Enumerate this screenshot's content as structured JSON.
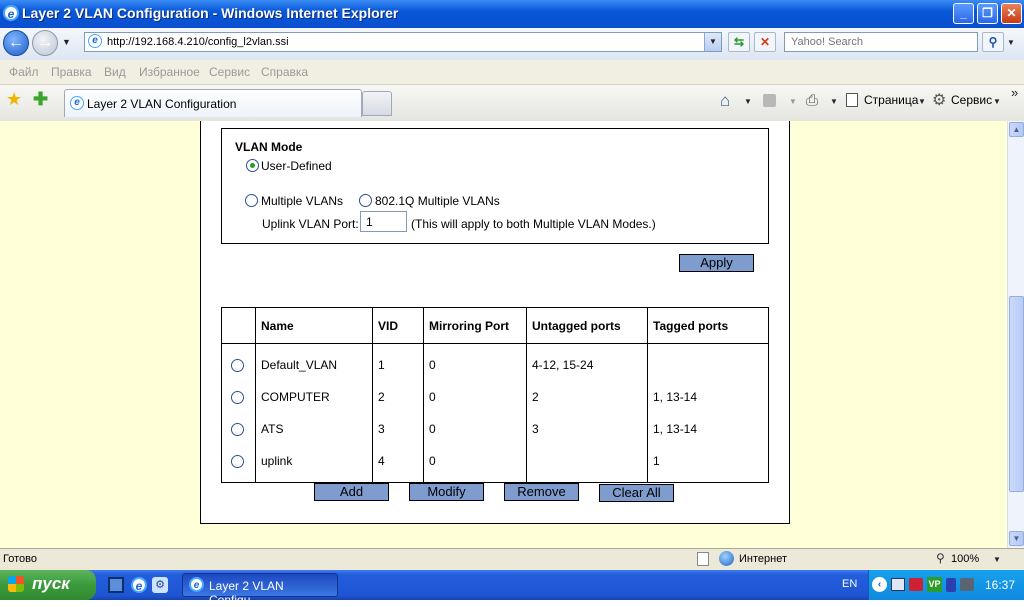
{
  "window": {
    "title": "Layer 2 VLAN Configuration - Windows Internet Explorer",
    "min": "_",
    "max": "❐",
    "close": "✕"
  },
  "address": {
    "url": "http://192.168.4.210/config_l2vlan.ssi",
    "search_placeholder": "Yahoo! Search"
  },
  "menu": [
    "Файл",
    "Правка",
    "Вид",
    "Избранное",
    "Сервис",
    "Справка"
  ],
  "tabs": {
    "active": "Layer 2 VLAN Configuration"
  },
  "commandbar": {
    "page": "Страница",
    "tools": "Сервис",
    "more": "»"
  },
  "vlan_mode": {
    "heading": "VLAN Mode",
    "user_defined": "User-Defined",
    "multiple_vlans": "Multiple VLANs",
    "dot1q_multiple": "802.1Q Multiple VLANs",
    "uplink_label": "Uplink VLAN Port:",
    "uplink_value": "1",
    "uplink_note": "(This will apply to both Multiple VLAN Modes.)"
  },
  "buttons": {
    "apply": "Apply",
    "add": "Add",
    "modify": "Modify",
    "remove": "Remove",
    "clear_all": "Clear All"
  },
  "table": {
    "headers": [
      "Name",
      "VID",
      "Mirroring Port",
      "Untagged ports",
      "Tagged ports"
    ],
    "rows": [
      {
        "name": "Default_VLAN",
        "vid": "1",
        "mirror": "0",
        "untagged": "4-12, 15-24",
        "tagged": ""
      },
      {
        "name": "COMPUTER",
        "vid": "2",
        "mirror": "0",
        "untagged": "2",
        "tagged": "1, 13-14"
      },
      {
        "name": "ATS",
        "vid": "3",
        "mirror": "0",
        "untagged": "3",
        "tagged": "1, 13-14"
      },
      {
        "name": "uplink",
        "vid": "4",
        "mirror": "0",
        "untagged": "",
        "tagged": "1"
      }
    ]
  },
  "status": {
    "left": "Готово",
    "zone": "Интернет",
    "zoom": "100%"
  },
  "taskbar": {
    "start": "пуск",
    "task": "Layer 2 VLAN Configu...",
    "lang": "EN",
    "time": "16:37"
  }
}
